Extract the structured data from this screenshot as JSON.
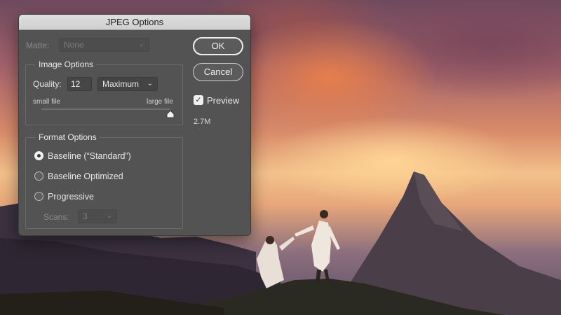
{
  "dialog": {
    "title": "JPEG Options",
    "matte": {
      "label": "Matte:",
      "value": "None"
    },
    "image_options": {
      "title": "Image Options",
      "quality_label": "Quality:",
      "quality_value": "12",
      "quality_preset": "Maximum",
      "small_file_label": "small file",
      "large_file_label": "large file",
      "slider_fraction": 1.0
    },
    "format_options": {
      "title": "Format Options",
      "options": [
        {
          "label": "Baseline (“Standard”)",
          "selected": true
        },
        {
          "label": "Baseline Optimized",
          "selected": false
        },
        {
          "label": "Progressive",
          "selected": false
        }
      ],
      "scans_label": "Scans:",
      "scans_value": "3"
    },
    "buttons": {
      "ok": "OK",
      "cancel": "Cancel"
    },
    "preview": {
      "label": "Preview",
      "checked": true
    },
    "file_size": "2.7M"
  },
  "colors": {
    "dialog_bg": "#535353",
    "titlebar_bg": "#d6d6d6"
  }
}
